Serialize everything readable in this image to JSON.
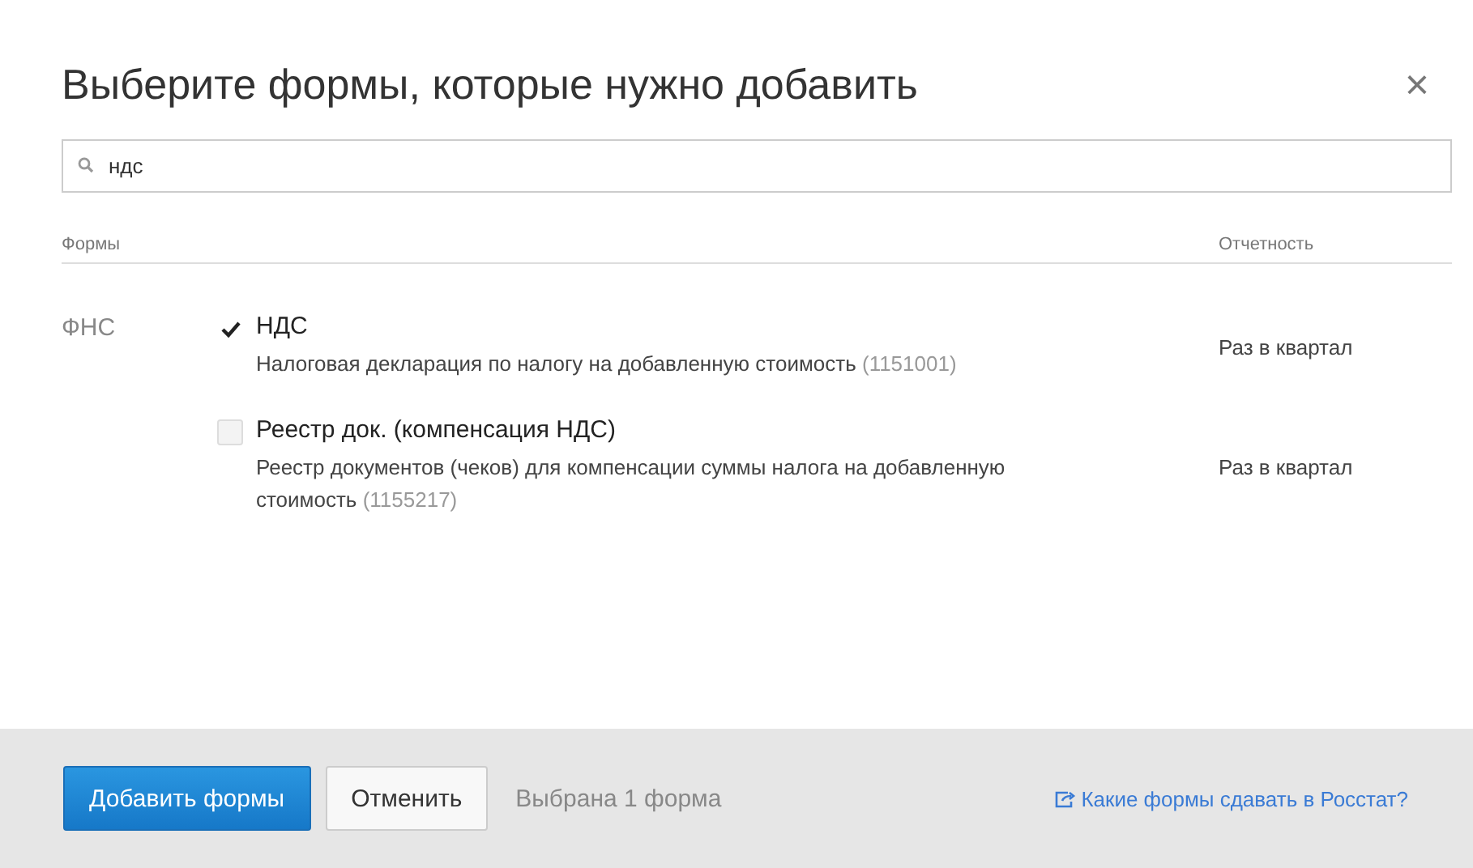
{
  "dialog": {
    "title": "Выберите формы, которые нужно добавить",
    "close": "×"
  },
  "search": {
    "value": "ндс"
  },
  "table": {
    "columns": [
      "Формы",
      "Отчетность"
    ],
    "groups": [
      {
        "label": "ФНС",
        "forms": [
          {
            "name": "НДС",
            "description": "Налоговая декларация по налогу на добавленную стоимость",
            "code": "(1151001)",
            "frequency": "Раз в квартал",
            "checked": true
          },
          {
            "name": "Реестр док. (компенсация НДС)",
            "description": "Реестр документов (чеков) для компенсации суммы налога на добавленную стоимость",
            "code": "(1155217)",
            "frequency": "Раз в квартал",
            "checked": false
          }
        ]
      }
    ]
  },
  "footer": {
    "primary": "Добавить формы",
    "cancel": "Отменить",
    "status": "Выбрана 1 форма",
    "link": "Какие формы сдавать в Росстат?"
  }
}
